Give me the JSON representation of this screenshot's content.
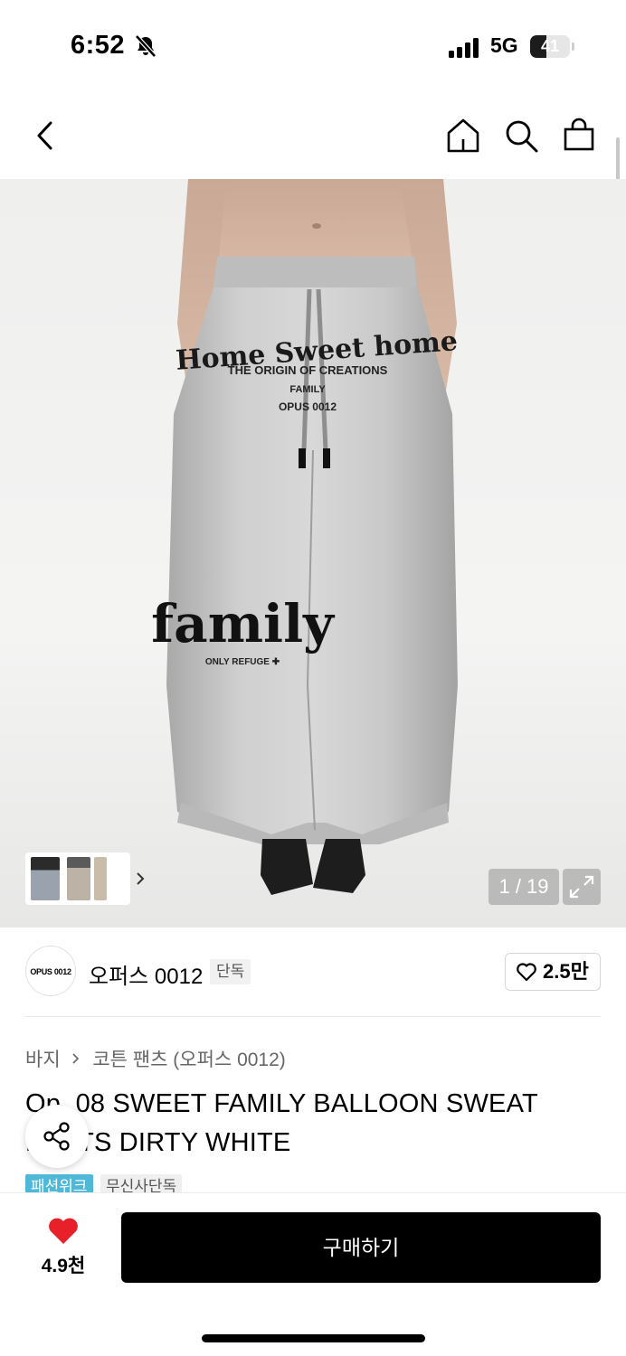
{
  "status_bar": {
    "time": "6:52",
    "network": "5G",
    "battery": "41",
    "battery_level_percent": 41,
    "icons": [
      "bell-slash-icon",
      "signal-icon",
      "battery-icon"
    ]
  },
  "nav": {
    "icons": [
      "back-chevron-icon",
      "home-icon",
      "search-icon",
      "shopping-bag-icon"
    ]
  },
  "gallery": {
    "counter": "1 / 19",
    "image_text": {
      "line1": "Home Sweet home",
      "line2": "THE ORIGIN OF CREATIONS",
      "line3": "FAMILY",
      "line4": "OPUS 0012",
      "leg_text": "family",
      "leg_sub": "ONLY REFUGE ✚"
    },
    "icons": [
      "chevron-right-icon",
      "expand-icon"
    ]
  },
  "brand": {
    "logo_text": "OPUS 0012",
    "name": "오퍼스 0012",
    "badge": "단독",
    "likes": "2.5만"
  },
  "product": {
    "breadcrumb": [
      "바지",
      "코튼 팬츠 (오퍼스 0012)"
    ],
    "title": "Op. 08 SWEET FAMILY BALLOON SWEAT PANTS DIRTY WHITE",
    "tags": [
      "패션위크",
      "무신사단독"
    ]
  },
  "bottom_bar": {
    "wish_count": "4.9천",
    "buy_label": "구매하기"
  },
  "colors": {
    "accent_tag": "#4fb8d8",
    "heart": "#e8202a",
    "buy_button": "#000000"
  }
}
